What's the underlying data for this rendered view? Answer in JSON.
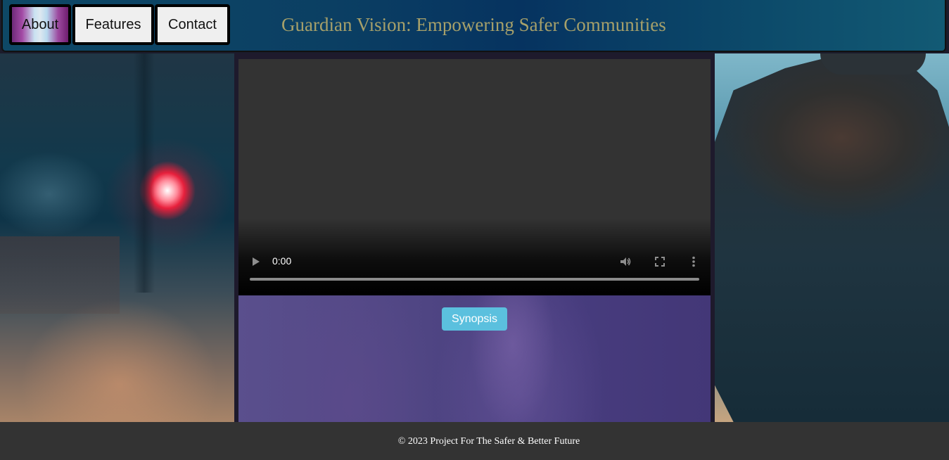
{
  "nav": {
    "items": [
      {
        "label": "About"
      },
      {
        "label": "Features"
      },
      {
        "label": "Contact"
      }
    ]
  },
  "header": {
    "title": "Guardian Vision: Empowering Safer Communities"
  },
  "video": {
    "time": "0:00",
    "progress": 0,
    "icons": [
      "play-icon",
      "volume-icon",
      "fullscreen-icon",
      "more-options-icon"
    ]
  },
  "panel": {
    "button_label": "Synopsis",
    "button_color": "#5bc0de"
  },
  "footer": {
    "text": "© 2023 Project For The Safer & Better Future"
  }
}
